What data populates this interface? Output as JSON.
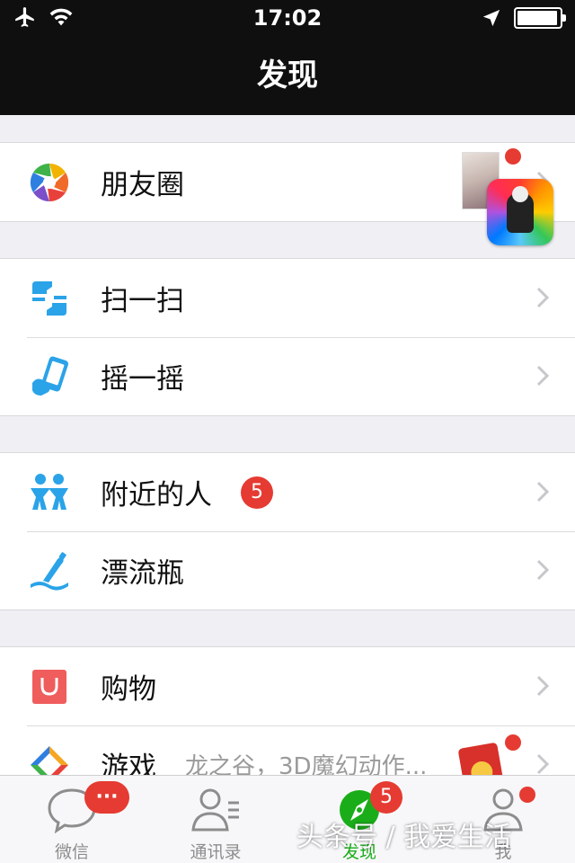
{
  "status_bar": {
    "time": "17:02",
    "battery_level": 0.95
  },
  "nav": {
    "title": "发现"
  },
  "groups": [
    {
      "items": [
        {
          "label": "朋友圈"
        }
      ]
    },
    {
      "items": [
        {
          "label": "扫一扫"
        },
        {
          "label": "摇一摇"
        }
      ]
    },
    {
      "items": [
        {
          "label": "附近的人",
          "badge": "5"
        },
        {
          "label": "漂流瓶"
        }
      ]
    },
    {
      "items": [
        {
          "label": "购物"
        },
        {
          "label": "游戏",
          "subtitle": "龙之谷，3D魔幻动作..."
        }
      ]
    }
  ],
  "icons": {
    "moments": "aperture-icon",
    "scan": "scan-icon",
    "shake": "shake-phone-icon",
    "nearby": "people-icon",
    "bottle": "drift-bottle-icon",
    "shopping": "shopping-bag-icon",
    "games": "game-diamond-icon"
  },
  "tabbar": {
    "tabs": [
      {
        "label": "微信",
        "badge": "···"
      },
      {
        "label": "通讯录"
      },
      {
        "label": "发现",
        "badge": "5",
        "active": true
      },
      {
        "label": "我"
      }
    ]
  },
  "watermark": "头条号 / 我爱生活",
  "colors": {
    "accent_green": "#1aad19",
    "badge_red": "#e53b32",
    "nav_bg": "#0f0f0f",
    "icon_blue": "#2aa3e8"
  }
}
